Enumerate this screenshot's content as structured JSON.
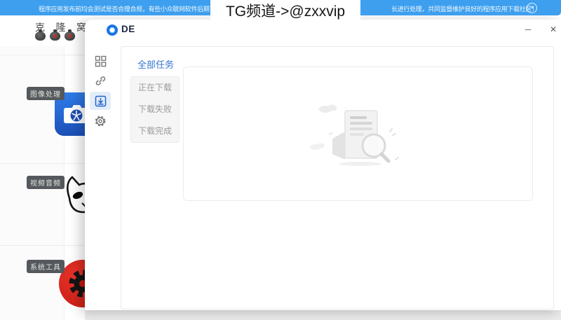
{
  "banner": {
    "text_left": "程序应用发布前均会测试是否合理合规，有些小众联网软件后期可能",
    "text_right": "长进行处理，共同监督维护良好的程序应用下载社区！",
    "close_glyph": "✕",
    "bg_color": "#3d9fee"
  },
  "overlay": {
    "tg_text": "TG频道->@zxxvip"
  },
  "bg_app": {
    "title": "克 隆 窝",
    "header_icons": [
      "pouch-icon",
      "pouch-icon",
      "pouch-icon"
    ],
    "categories": {
      "image": "图像处理",
      "media": "视频音频",
      "system": "系统工具"
    },
    "app_icons": [
      "camera-app-icon",
      "cat-app-icon",
      "red-gear-app-icon"
    ]
  },
  "dialog": {
    "logo_text": "DE",
    "controls": {
      "minimize": "─",
      "close": "✕"
    },
    "sidebar_icons": [
      "apps-grid-icon",
      "link-icon",
      "download-icon",
      "settings-gear-icon"
    ],
    "active_sidebar": "download-icon",
    "tabs": {
      "all": "全部任务",
      "filters": [
        "正在下载",
        "下载失败",
        "下载完成"
      ]
    },
    "empty_state_icon": "document-search-illustration"
  },
  "colors": {
    "banner_bg": "#3d9fee",
    "accent_blue": "#3274cf",
    "active_icon_bg": "#e3edfa",
    "badge_bg": "#55585c",
    "red_app_icon": "#d8241a",
    "camera_app_icon": "#2669d6"
  }
}
